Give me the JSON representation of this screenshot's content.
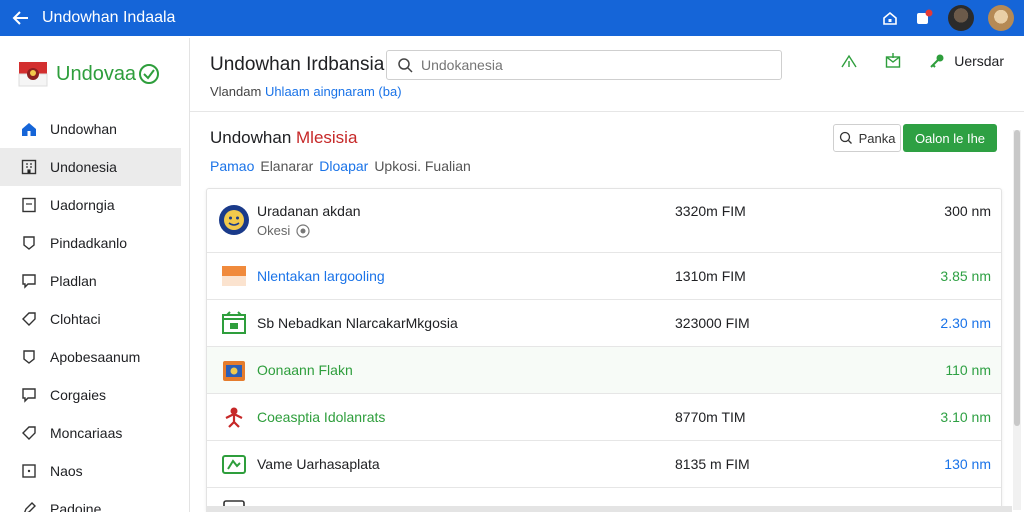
{
  "topbar": {
    "title": "Undowhan Indaala",
    "color": "#1565d8"
  },
  "sidebar": {
    "brand": "Undovaa",
    "items": [
      {
        "label": "Undowhan",
        "icon": "home-icon"
      },
      {
        "label": "Undonesia",
        "icon": "building-icon"
      },
      {
        "label": "Uadorngia",
        "icon": "document-icon"
      },
      {
        "label": "Pindadkanlo",
        "icon": "shield-icon"
      },
      {
        "label": "Pladlan",
        "icon": "chat-icon"
      },
      {
        "label": "Clohtaci",
        "icon": "tag-icon"
      },
      {
        "label": "Apobesaanum",
        "icon": "shield-icon"
      },
      {
        "label": "Corgaies",
        "icon": "chat-icon"
      },
      {
        "label": "Moncariaas",
        "icon": "tag-icon"
      },
      {
        "label": "Naos",
        "icon": "image-icon"
      },
      {
        "label": "Padoine",
        "icon": "pen-icon"
      }
    ]
  },
  "header": {
    "title": "Undowhan Irdbansia",
    "subtitle_plain": "Vlandam",
    "subtitle_link": "Uhlaam aingnaram",
    "subtitle_badge": "(ba)",
    "search_placeholder": "Undokanesia",
    "action_label": "Uersdar"
  },
  "section": {
    "title_plain": "Undowhan",
    "title_red": "Mlesisia",
    "filter_blue": "Pamao",
    "filter_plain": "Elanarar",
    "filter_blue2": "Dloapar",
    "filter_rest": "Upkosi. Fualian",
    "btn_outline": "Panka",
    "btn_green": "Oalon le Ihe"
  },
  "rows": [
    {
      "name": "Uradanan akdan",
      "sub": "Okesi",
      "time": "3320m FIM",
      "amount": "300 nm",
      "name_style": "plain",
      "amount_style": "plain",
      "icon": "emblem-icon"
    },
    {
      "name": "Nlentakan largooling",
      "sub": "",
      "time": "1310m FIM",
      "amount": "3.85 nm",
      "name_style": "blue",
      "amount_style": "green",
      "icon": "flag-icon"
    },
    {
      "name": "Sb Nebadkan NlarcakarMkgosia",
      "sub": "",
      "time": "323000 FIM",
      "amount": "2.30 nm",
      "name_style": "plain",
      "amount_style": "blue",
      "icon": "shop-icon"
    },
    {
      "name": "Oonaann Flakn",
      "sub": "",
      "time": "",
      "amount": "110 nm",
      "name_style": "green",
      "amount_style": "green",
      "icon": "box-icon"
    },
    {
      "name": "Coeasptia Idolanrats",
      "sub": "",
      "time": "8770m TIM",
      "amount": "3.10 nm",
      "name_style": "green",
      "amount_style": "green",
      "icon": "figure-icon"
    },
    {
      "name": "Vame Uarhasaplata",
      "sub": "",
      "time": "8135 m FIM",
      "amount": "130 nm",
      "name_style": "plain",
      "amount_style": "blue",
      "icon": "ticket-icon"
    }
  ]
}
